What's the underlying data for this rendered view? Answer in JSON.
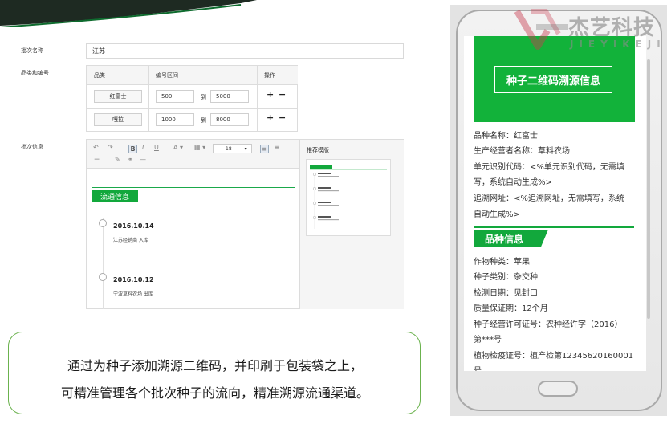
{
  "form": {
    "batch_name_label": "批次名称",
    "batch_name_value": "江苏",
    "category_label": "品类和编号",
    "table_headers": [
      "品类",
      "编号区间",
      "操作"
    ],
    "rows": [
      {
        "category": "红富士",
        "from": "500",
        "to_label": "到",
        "to": "5000",
        "add": "+",
        "remove": "−"
      },
      {
        "category": "嘎拉",
        "from": "1000",
        "to_label": "到",
        "to": "8000",
        "add": "+",
        "remove": "−"
      }
    ],
    "batch_info_label": "批次信息"
  },
  "editor": {
    "font_size": "18",
    "badge": "流通信息",
    "timeline": [
      {
        "date": "2016.10.14",
        "desc": "江苏经销商 入库"
      },
      {
        "date": "2016.10.12",
        "desc": "宁波草料农场 出库"
      }
    ],
    "template_title": "推荐模版"
  },
  "callout": {
    "line1": "通过为种子添加溯源二维码，并印刷于包装袋之上，",
    "line2": "可精准管理各个批次种子的流向，精准溯源流通渠道。"
  },
  "phone": {
    "hero_button": "种子二维码溯源信息",
    "info_lines": [
      "品种名称：红富士",
      "生产经营者名称：草料农场",
      "单元识别代码：<%单元识别代码，无需填",
      "写，系统自动生成%>",
      "追溯网址：<%追溯网址，无需填写，系统",
      "自动生成%>"
    ],
    "section_title": "品种信息",
    "detail_lines": [
      "作物种类：苹果",
      "种子类别：杂交种",
      "检测日期：见封口",
      "质量保证期：12个月",
      "种子经营许可证号：农种经许字（2016）",
      "第***号",
      "植物检疫证号：植产检第12345620160001",
      "号"
    ]
  },
  "logo": {
    "main": "杰艺科技",
    "sub": "JIEYIKEJI"
  },
  "colors": {
    "accent_green": "#12a83c",
    "callout_border": "#6bb24e"
  }
}
